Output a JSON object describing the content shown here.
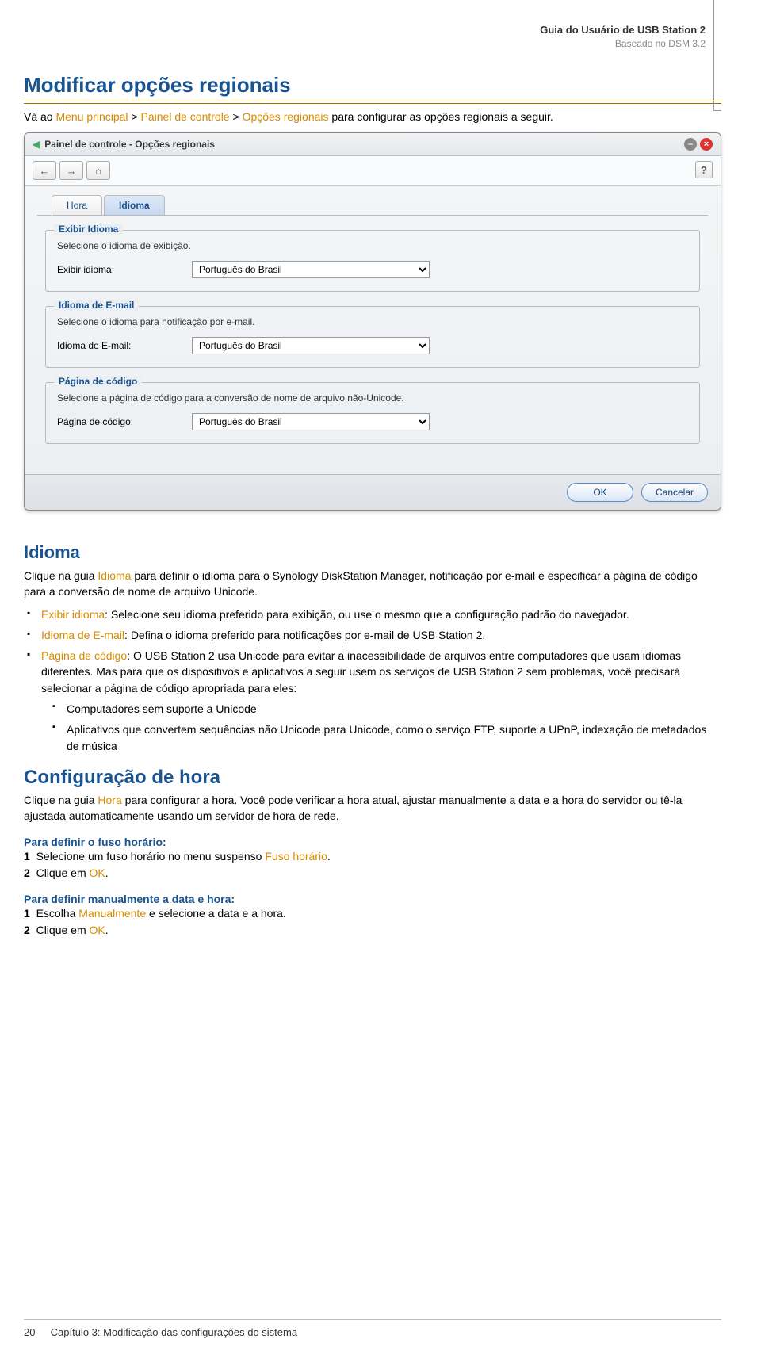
{
  "header": {
    "title": "Guia do Usuário de USB Station 2",
    "subtitle": "Baseado no DSM 3.2"
  },
  "section1": {
    "title": "Modificar opções regionais",
    "intro_prefix": "Vá ao ",
    "kw_menu": "Menu principal",
    "sep1": " > ",
    "kw_painel": "Painel de controle",
    "sep2": " > ",
    "kw_opcoes": "Opções regionais",
    "intro_suffix": " para configurar as opções regionais a seguir."
  },
  "screenshot": {
    "window_title": "Painel de controle - Opções regionais",
    "help_btn": "?",
    "tabs": {
      "hora": "Hora",
      "idioma": "Idioma"
    },
    "fs1": {
      "legend": "Exibir Idioma",
      "desc": "Selecione o idioma de exibição.",
      "label": "Exibir idioma:",
      "value": "Português do Brasil"
    },
    "fs2": {
      "legend": "Idioma de E-mail",
      "desc": "Selecione o idioma para notificação por e-mail.",
      "label": "Idioma de E-mail:",
      "value": "Português do Brasil"
    },
    "fs3": {
      "legend": "Página de código",
      "desc": "Selecione a página de código para a conversão de nome de arquivo não-Unicode.",
      "label": "Página de código:",
      "value": "Português do Brasil"
    },
    "buttons": {
      "ok": "OK",
      "cancel": "Cancelar"
    }
  },
  "idioma": {
    "heading": "Idioma",
    "p_prefix": "Clique na guia ",
    "p_kw": "Idioma",
    "p_suffix": " para definir o idioma para o Synology DiskStation Manager, notificação por e-mail e especificar a página de código para a conversão de nome de arquivo Unicode.",
    "b1_kw": "Exibir idioma",
    "b1_text": ": Selecione seu idioma preferido para exibição, ou use o mesmo que a configuração padrão do navegador.",
    "b2_kw": "Idioma de E-mail",
    "b2_text": ": Defina o idioma preferido para notificações por e-mail de USB Station 2.",
    "b3_kw": "Página de código",
    "b3_text": ": O USB Station 2 usa Unicode para evitar a inacessibilidade de arquivos entre computadores que usam idiomas diferentes. Mas para que os dispositivos e aplicativos a seguir usem os serviços de USB Station 2 sem problemas, você precisará selecionar a página de código apropriada para eles:",
    "b3_sub1": "Computadores sem suporte a Unicode",
    "b3_sub2": "Aplicativos que convertem sequências não Unicode para Unicode, como o serviço FTP, suporte a UPnP, indexação de metadados de música"
  },
  "config_hora": {
    "heading": "Configuração de hora",
    "p_prefix": "Clique na guia ",
    "p_kw": "Hora",
    "p_suffix": " para configurar a hora. Você pode verificar a hora atual, ajustar manualmente a data e a hora do servidor ou tê-la ajustada automaticamente usando um servidor de hora de rede.",
    "step1_head": "Para definir o fuso horário:",
    "step1_1_num": "1",
    "step1_1_prefix": "Selecione um fuso horário no menu suspenso ",
    "step1_1_kw": "Fuso horário",
    "step1_1_suffix": ".",
    "step1_2_num": "2",
    "step1_2_prefix": "Clique em ",
    "step1_2_kw": "OK",
    "step1_2_suffix": ".",
    "step2_head": "Para definir manualmente a data e hora:",
    "step2_1_num": "1",
    "step2_1_prefix": "Escolha ",
    "step2_1_kw": "Manualmente",
    "step2_1_suffix": " e selecione a data e a hora.",
    "step2_2_num": "2",
    "step2_2_prefix": "Clique em ",
    "step2_2_kw": "OK",
    "step2_2_suffix": "."
  },
  "footer": {
    "page": "20",
    "chapter": "Capítulo 3: Modificação das configurações do sistema"
  }
}
